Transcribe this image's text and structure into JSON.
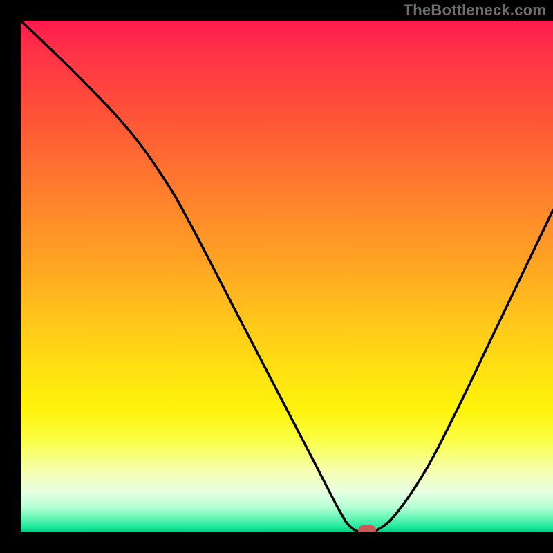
{
  "watermark": "TheBottleneck.com",
  "colors": {
    "frame": "#000000",
    "curve": "#000000",
    "marker": "#c85a5a",
    "watermark": "#6e6e6e"
  },
  "chart_data": {
    "type": "line",
    "title": "",
    "xlabel": "",
    "ylabel": "",
    "xlim": [
      0,
      100
    ],
    "ylim": [
      0,
      100
    ],
    "x": [
      0,
      10,
      20,
      27,
      32,
      40,
      48,
      55,
      60,
      62,
      64,
      66,
      70,
      76,
      82,
      88,
      94,
      100
    ],
    "values": [
      100,
      90,
      79,
      69,
      60,
      44,
      28,
      14,
      4,
      1,
      0,
      0,
      3,
      12,
      24,
      37,
      50,
      63
    ],
    "marker": {
      "x": 65,
      "y": 0
    },
    "background_gradient": [
      {
        "stop": 0.0,
        "color": "#ff1a4d"
      },
      {
        "stop": 0.5,
        "color": "#ffbf1f"
      },
      {
        "stop": 0.8,
        "color": "#fff30a"
      },
      {
        "stop": 0.97,
        "color": "#6cf7b8"
      },
      {
        "stop": 1.0,
        "color": "#00c97d"
      }
    ]
  }
}
